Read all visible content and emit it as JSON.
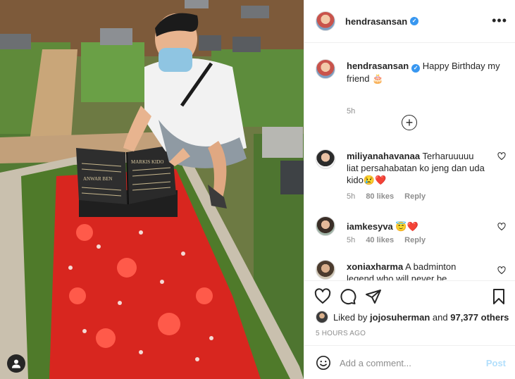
{
  "post": {
    "author": "hendrasansan",
    "verified": true,
    "menu_icon": "more-horizontal-icon"
  },
  "photo": {
    "tomb_names": [
      "ANWAR BEN",
      "MARKIS KIDO"
    ],
    "user_tag_icon": "user-icon"
  },
  "caption": {
    "username": "hendrasansan",
    "text": "Happy Birthday my friend 🎂",
    "time": "5h"
  },
  "load_more_icon": "plus-circle-icon",
  "comments": [
    {
      "username": "miliyanahavanaa",
      "text": "Terharuuuuu liat persahabatan ko jeng dan uda kido😢❤️",
      "time": "5h",
      "likes": "80 likes",
      "reply": "Reply"
    },
    {
      "username": "iamkesyva",
      "text": "😇❤️",
      "time": "5h",
      "likes": "40 likes",
      "reply": "Reply"
    },
    {
      "username": "xoniaxharma",
      "text": "A badminton legend who will never be"
    }
  ],
  "actions": {
    "like_icon": "heart-icon",
    "comment_icon": "comment-icon",
    "share_icon": "paper-plane-icon",
    "save_icon": "bookmark-icon"
  },
  "likes": {
    "prefix": "Liked by ",
    "user": "jojosuherman",
    "middle": " and ",
    "count": "97,377 others"
  },
  "post_time": "5 HOURS AGO",
  "add_comment": {
    "placeholder": "Add a comment...",
    "post_label": "Post",
    "emoji_icon": "smiley-icon"
  },
  "colors": {
    "verified": "#3897f0",
    "post_button": "#b2dffc",
    "secondary_text": "#8e8e8e"
  }
}
